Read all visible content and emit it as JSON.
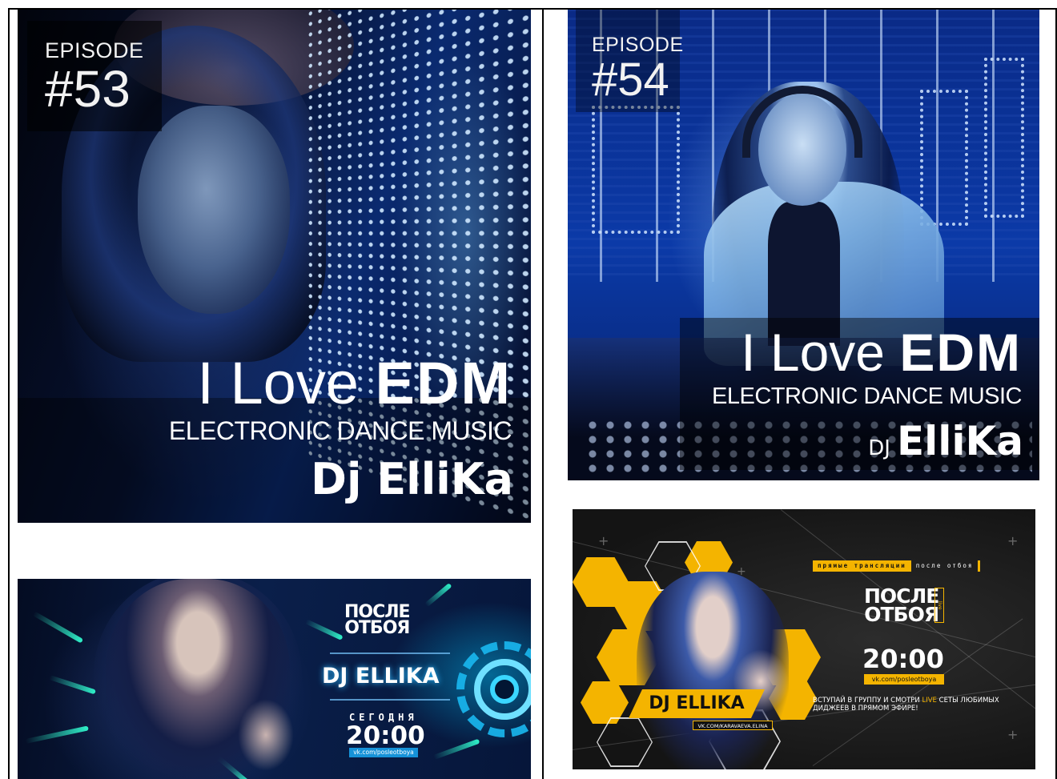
{
  "cover53": {
    "episode_word": "EPISODE",
    "episode_number": "#53",
    "title_thin": "I Love ",
    "title_bold": "EDM",
    "subtitle": "ELECTRONIC DANCE MUSIC",
    "dj_name": "Dj ElliKa"
  },
  "cover54": {
    "episode_word": "EPISODE",
    "episode_number": "#54",
    "title_thin": "I Love ",
    "title_bold": "EDM",
    "subtitle": "ELECTRONIC DANCE MUSIC",
    "dj_prefix": "DJ",
    "dj_name": "ElliKa"
  },
  "banner_blue": {
    "logo_line1": "ПОСЛЕ",
    "logo_line2": "ОТБОЯ",
    "dj_label": "DJ ELLIKA",
    "today": "СЕГОДНЯ",
    "time": "20:00",
    "url": "vk.com/posleotboya"
  },
  "banner_yellow": {
    "tag_lead": "прямые трансляции",
    "tag_tail": "после отбоя",
    "logo_line1": "ПОСЛЕ",
    "logo_line2": "ОТБОЯ",
    "live_mark": "live",
    "time": "20:00",
    "url": "vk.com/posleotboya",
    "promo_before": "ВСТУПАЙ В ГРУППУ И СМОТРИ ",
    "promo_live": "LIVE",
    "promo_after": " СЕТЫ ЛЮБИМЫХ ДИДЖЕЕВ  В ПРЯМОМ ЭФИРЕ!",
    "dj_label": "DJ ELLIKA",
    "vk_link": "VK.COM/KARAVAEVA.ELINA"
  },
  "colors": {
    "accent_yellow": "#f4b400",
    "accent_cyan": "#19b8f0",
    "frame_black": "#000000"
  }
}
